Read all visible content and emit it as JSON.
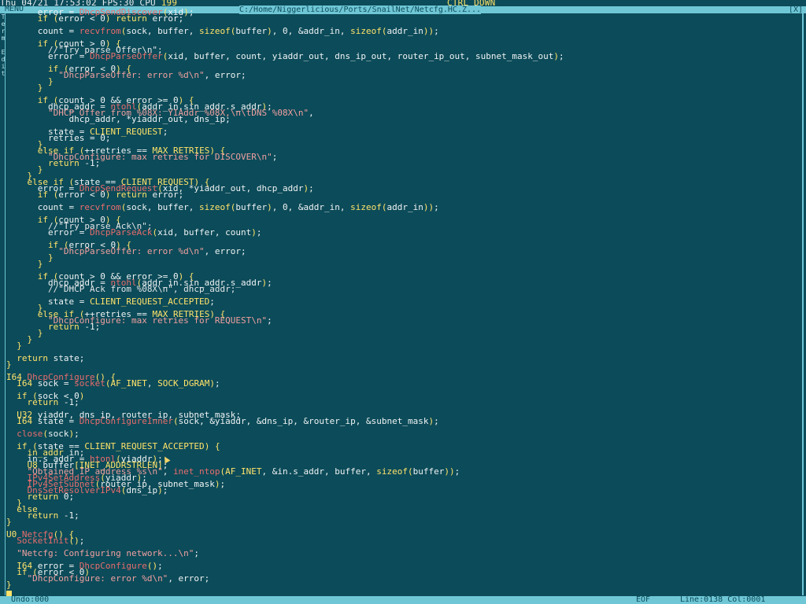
{
  "topbar": {
    "clock": "Thu 04/21 17:53:02 FPS:30 CPU ",
    "cpu": "199",
    "ctrl_down": "CTRL DOWN"
  },
  "titlebar": {
    "menu": "MENU",
    "path": "C:/Home/Niggerlicious/Ports/SnailNet/Netcfg.HC.Z...",
    "close": "[X]"
  },
  "sidebar": {
    "letters": [
      "T",
      "e",
      "r",
      "m",
      "",
      "E",
      "d",
      "i",
      "t"
    ]
  },
  "statusbar": {
    "undo": "Undo:000",
    "eof": "EOF",
    "line_col": "Line:0138 Col:0001"
  },
  "code": [
    "      error = DhcpSendDiscover(xid);",
    "      if (error < 0) return error;",
    "",
    "      count = recvfrom(sock, buffer, sizeof(buffer), 0, &addr_in, sizeof(addr_in));",
    "",
    "      if (count > 0) {",
    "        //\"Try parse Offer\\n\";",
    "        error = DhcpParseOffer(xid, buffer, count, yiaddr_out, dns_ip_out, router_ip_out, subnet_mask_out);",
    "",
    "        if (error < 0) {",
    "          \"DhcpParseOffer: error %d\\n\", error;",
    "        }",
    "      }",
    "",
    "      if (count > 0 && error >= 0) {",
    "        dhcp_addr = ntohl(addr_in.sin_addr.s_addr);",
    "        \"DHCP Offer from %08X: YIAddr %08X,\\n\\tDNS %08X\\n\",",
    "            dhcp_addr, *yiaddr_out, dns_ip;",
    "",
    "        state = CLIENT_REQUEST;",
    "        retries = 0;",
    "      }",
    "      else if (++retries == MAX_RETRIES) {",
    "        \"DhcpConfigure: max retries for DISCOVER\\n\";",
    "        return -1;",
    "      }",
    "    }",
    "    else if (state == CLIENT_REQUEST) {",
    "      error = DhcpSendRequest(xid, *yiaddr_out, dhcp_addr);",
    "      if (error < 0) return error;",
    "",
    "      count = recvfrom(sock, buffer, sizeof(buffer), 0, &addr_in, sizeof(addr_in));",
    "",
    "      if (count > 0) {",
    "        //\"Try parse Ack\\n\";",
    "        error = DhcpParseAck(xid, buffer, count);",
    "",
    "        if (error < 0) {",
    "          \"DhcpParseOffer: error %d\\n\", error;",
    "        }",
    "      }",
    "",
    "      if (count > 0 && error >= 0) {",
    "        dhcp_addr = ntohl(addr_in.sin_addr.s_addr);",
    "        //\"DHCP Ack from %08X\\n\", dhcp_addr;",
    "",
    "        state = CLIENT_REQUEST_ACCEPTED;",
    "      }",
    "      else if (++retries == MAX_RETRIES) {",
    "        \"DhcpConfigure: max retries for REQUEST\\n\";",
    "        return -1;",
    "      }",
    "    }",
    "  }",
    "",
    "  return state;",
    "}",
    "",
    "I64 DhcpConfigure() {",
    "  I64 sock = socket(AF_INET, SOCK_DGRAM);",
    "",
    "  if (sock < 0)",
    "    return -1;",
    "",
    "  U32 yiaddr, dns_ip, router_ip, subnet_mask;",
    "  I64 state = DhcpConfigureInner(sock, &yiaddr, &dns_ip, &router_ip, &subnet_mask);",
    "",
    "  close(sock);",
    "",
    "  if (state == CLIENT_REQUEST_ACCEPTED) {",
    "    in_addr in;",
    "    in.s_addr = htonl(yiaddr);",
    "    U8 buffer[INET_ADDRSTRLEN];",
    "    \"Obtained IP address %s\\n\", inet_ntop(AF_INET, &in.s_addr, buffer, sizeof(buffer));",
    "    IPv4SetAddress(yiaddr);",
    "    IPv4SetSubnet(router_ip, subnet_mask);",
    "    DnsSetResolverIPv4(dns_ip);",
    "    return 0;",
    "  }",
    "  else",
    "    return -1;",
    "}",
    "",
    "U0 Netcfg() {",
    "  SocketInit();",
    "",
    "  \"Netcfg: Configuring network...\\n\";",
    "",
    "  I64 error = DhcpConfigure();",
    "  if (error < 0)",
    "    \"DhcpConfigure: error %d\\n\", error;",
    "}"
  ]
}
